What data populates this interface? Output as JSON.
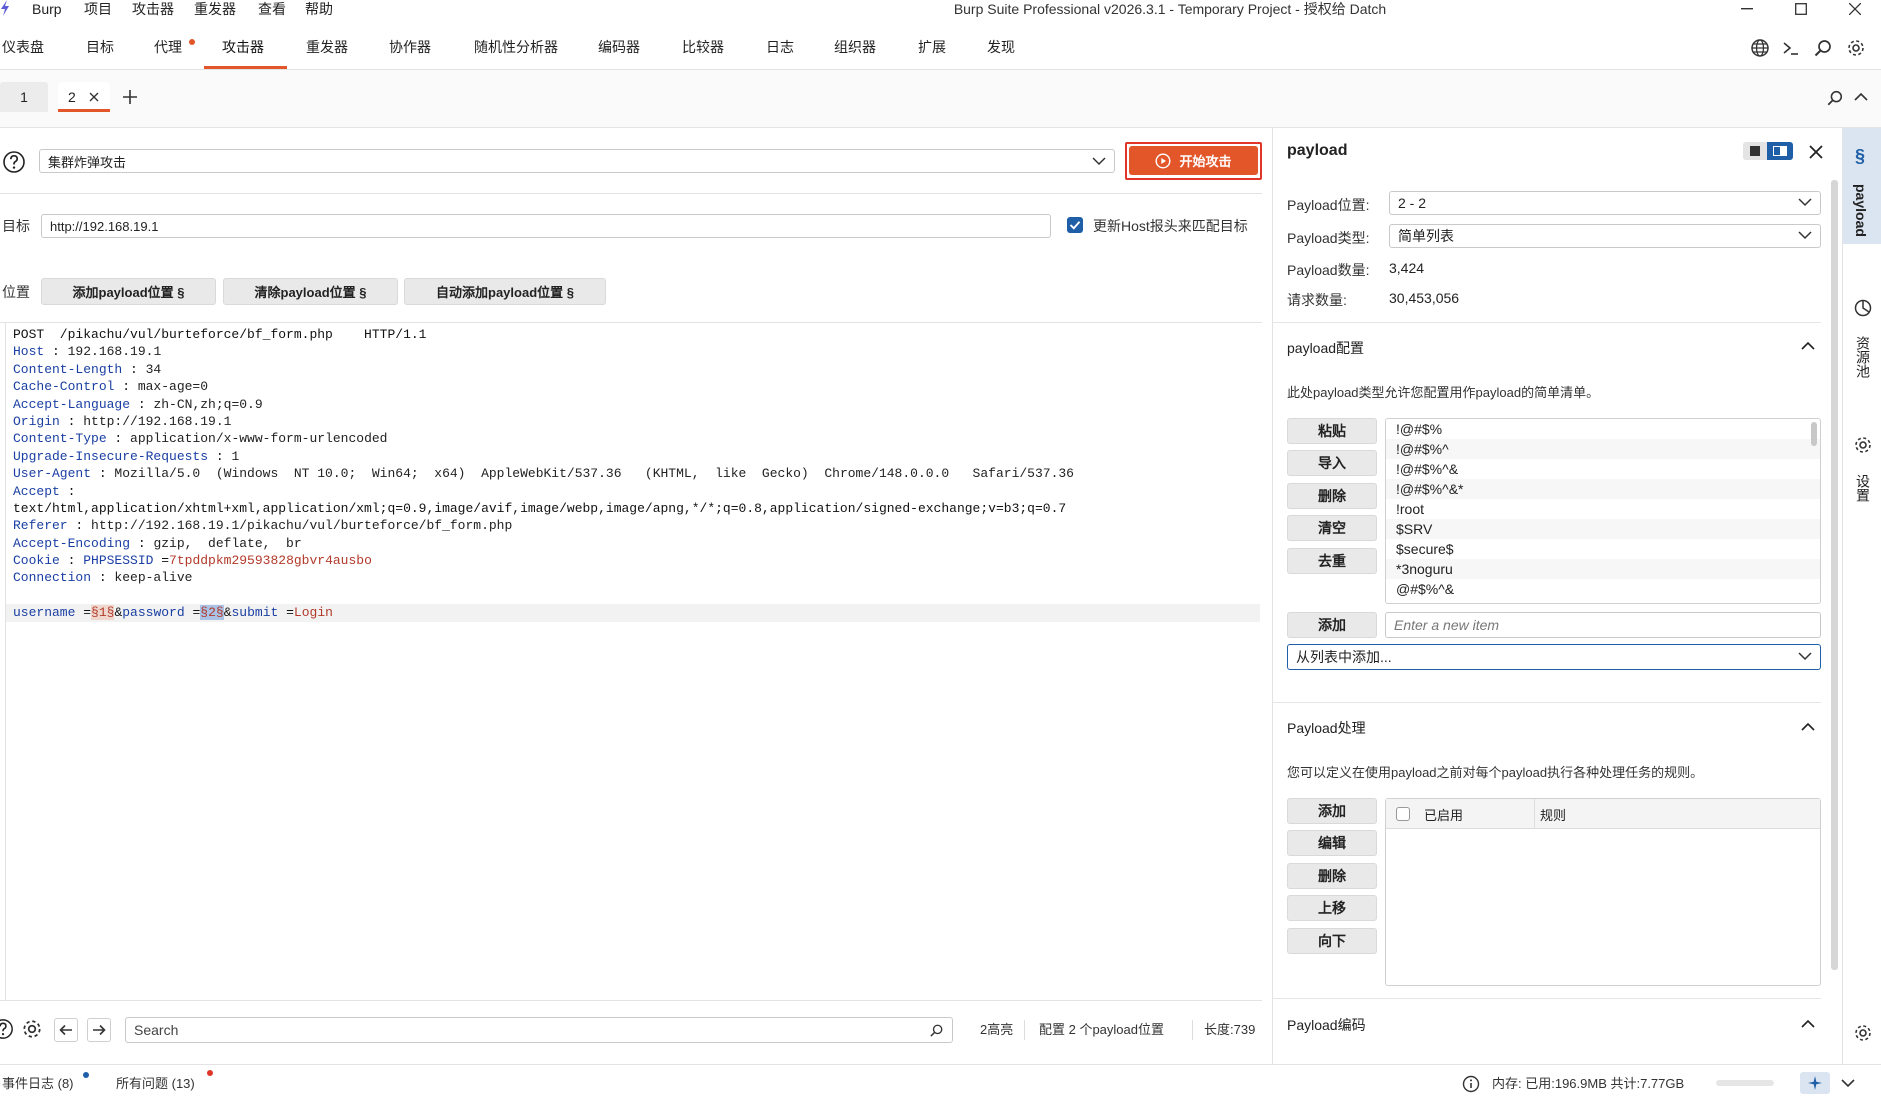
{
  "window": {
    "app_name": "Burp",
    "menus": [
      "项目",
      "攻击器",
      "重发器",
      "查看",
      "帮助"
    ],
    "title": "Burp Suite Professional v2026.3.1 - Temporary Project - 授权给 Datch"
  },
  "main_tabs": [
    "仪表盘",
    "目标",
    "代理",
    "攻击器",
    "重发器",
    "协作器",
    "随机性分析器",
    "编码器",
    "比较器",
    "日志",
    "组织器",
    "扩展",
    "发现"
  ],
  "sub_tabs": [
    "1",
    "2"
  ],
  "attack": {
    "type": "集群炸弹攻击",
    "start_label": "开始攻击"
  },
  "target": {
    "label": "目标",
    "url": "http://192.168.19.1",
    "update_host_label": "更新Host报头来匹配目标",
    "update_host_checked": true
  },
  "positions": {
    "label": "位置",
    "add_label": "添加payload位置 §",
    "clear_label": "清除payload位置 §",
    "auto_label": "自动添加payload位置 §"
  },
  "request": {
    "line": "POST  /pikachu/vul/burteforce/bf_form.php    HTTP/1.1",
    "headers": [
      {
        "k": "Host",
        "v": "192.168.19.1"
      },
      {
        "k": "Content-Length",
        "v": "34"
      },
      {
        "k": "Cache-Control",
        "v": "max-age=0"
      },
      {
        "k": "Accept-Language",
        "v": "zh-CN,zh;q=0.9"
      },
      {
        "k": "Origin",
        "v": "http://192.168.19.1"
      },
      {
        "k": "Content-Type",
        "v": "application/x-www-form-urlencoded"
      },
      {
        "k": "Upgrade-Insecure-Requests",
        "v": "1"
      },
      {
        "k": "User-Agent",
        "v": "Mozilla/5.0  (Windows  NT 10.0;  Win64;  x64)  AppleWebKit/537.36   (KHTML,  like  Gecko)  Chrome/148.0.0.0   Safari/537.36"
      },
      {
        "k": "Accept",
        "v": ""
      }
    ],
    "accept_value": "text/html,application/xhtml+xml,application/xml;q=0.9,image/avif,image/webp,image/apng,*/*;q=0.8,application/signed-exchange;v=b3;q=0.7",
    "headers2": [
      {
        "k": "Referer",
        "v": "http://192.168.19.1/pikachu/vul/burteforce/bf_form.php"
      },
      {
        "k": "Accept-Encoding",
        "v": "gzip,  deflate,  br"
      }
    ],
    "cookie_key": "Cookie",
    "cookie_name": "PHPSESSID",
    "cookie_value": "7tpddpkm29593828gbvr4ausbo",
    "connection": {
      "k": "Connection",
      "v": "keep-alive"
    },
    "body": {
      "p1": "username",
      "m1": "§1§",
      "p2": "password",
      "m2": "§2§",
      "p3": "submit",
      "v3": "Login"
    }
  },
  "editor_bottom": {
    "search_placeholder": "Search",
    "highlights": "2高亮",
    "config": "配置 2 个payload位置",
    "length": "长度:739"
  },
  "status": {
    "event_log": "事件日志 (8)",
    "all_issues": "所有问题 (13)",
    "memory": "内存: 已用:196.9MB 共计:7.77GB"
  },
  "payload_panel": {
    "title": "payload",
    "position_label": "Payload位置:",
    "position_value": "2 - 2",
    "type_label": "Payload类型:",
    "type_value": "简单列表",
    "count_label": "Payload数量:",
    "count_value": "3,424",
    "requests_label": "请求数量:",
    "requests_value": "30,453,056",
    "config_title": "payload配置",
    "config_desc": "此处payload类型允许您配置用作payload的简单清单。",
    "list_buttons": [
      "粘贴",
      "导入",
      "删除",
      "清空",
      "去重"
    ],
    "items": [
      "!@#$%",
      "!@#$%^",
      "!@#$%^&",
      "!@#$%^&*",
      "!root",
      "$SRV",
      "$secure$",
      "*3noguru",
      "@#$%^&"
    ],
    "add_label": "添加",
    "add_placeholder": "Enter a new item",
    "from_list": "从列表中添加...",
    "processing_title": "Payload处理",
    "processing_desc": "您可以定义在使用payload之前对每个payload执行各种处理任务的规则。",
    "proc_buttons": [
      "添加",
      "编辑",
      "删除",
      "上移",
      "向下"
    ],
    "col_enabled": "已启用",
    "col_rule": "规则",
    "encoding_title": "Payload编码"
  },
  "rail": {
    "payload": "payload",
    "resource_pool": "资源池",
    "settings": "设置"
  },
  "colors": {
    "accent": "#e2562a",
    "checkbox": "#1f5fa8"
  }
}
